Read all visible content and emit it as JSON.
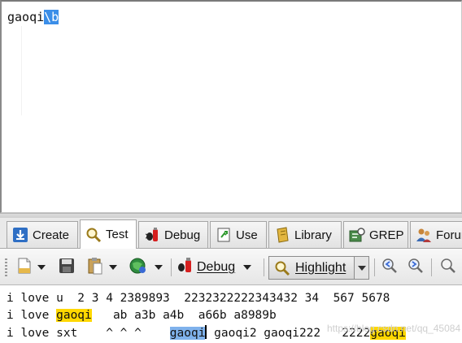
{
  "regex_editor": {
    "text_plain": "gaoqi",
    "text_selected": "\\b"
  },
  "tabs": [
    {
      "label": "Create",
      "icon": "create-icon"
    },
    {
      "label": "Test",
      "icon": "magnifier-icon"
    },
    {
      "label": "Debug",
      "icon": "debug-bug-icon"
    },
    {
      "label": "Use",
      "icon": "use-icon"
    },
    {
      "label": "Library",
      "icon": "library-icon"
    },
    {
      "label": "GREP",
      "icon": "grep-icon"
    },
    {
      "label": "Forum",
      "icon": "forum-users-icon"
    }
  ],
  "toolbar": {
    "debug_label": "Debug",
    "highlight_label": "Highlight"
  },
  "test_text": {
    "line1": "i love u  2 3 4 2389893  2232322222343432 34  567 5678",
    "line2_a": "i love ",
    "line2_match": "gaoqi",
    "line2_b": "   ab a3b a4b  a66b a8989b",
    "line3_a": "i love sxt    ^ ^ ^    ",
    "line3_match": "gaoqi",
    "line3_b": " gaoqi2 gaoqi222   2222",
    "line3_match2": "gaoqi"
  },
  "watermark": "https://blog.csdn.net/qq_45084",
  "colors": {
    "selection": "#3b8ee8",
    "match_highlight": "#ffd800",
    "current_match": "#7fb2ec"
  }
}
